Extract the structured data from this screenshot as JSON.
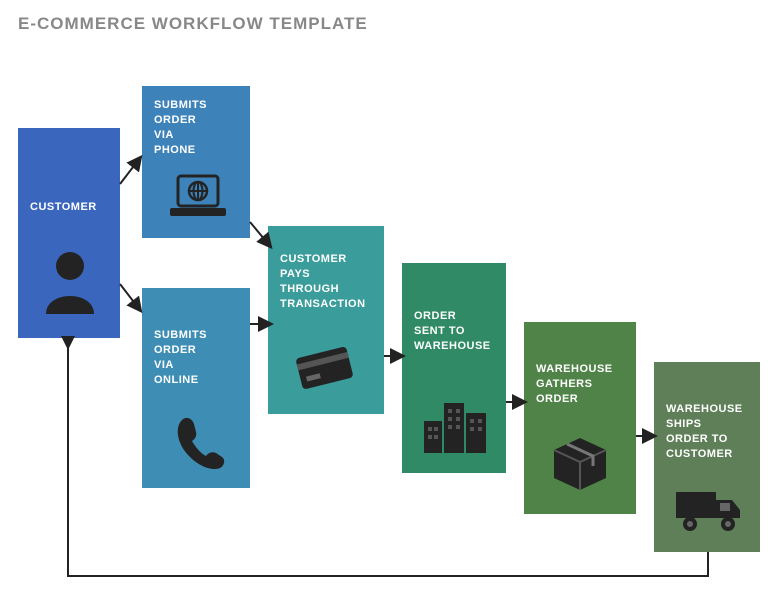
{
  "title": "E-COMMERCE WORKFLOW TEMPLATE",
  "boxes": {
    "customer": {
      "label": "CUSTOMER",
      "color": "#3a66bd"
    },
    "submits_phone": {
      "label": "SUBMITS\nORDER\nVIA\nPHONE",
      "color": "#3d83ba"
    },
    "submits_online": {
      "label": "SUBMITS\nORDER\nVIA\nONLINE",
      "color": "#3d8db4"
    },
    "customer_pays": {
      "label": "CUSTOMER\nPAYS\nTHROUGH\nTRANSACTION",
      "color": "#3a9c9b"
    },
    "order_warehouse": {
      "label": "ORDER\nSENT TO\nWAREHOUSE",
      "color": "#2f8a65"
    },
    "warehouse_gathers": {
      "label": "WAREHOUSE\nGATHERS\nORDER",
      "color": "#4f8347"
    },
    "warehouse_ships": {
      "label": "WAREHOUSE\nSHIPS\nORDER TO\nCUSTOMER",
      "color": "#5e7f57"
    }
  }
}
